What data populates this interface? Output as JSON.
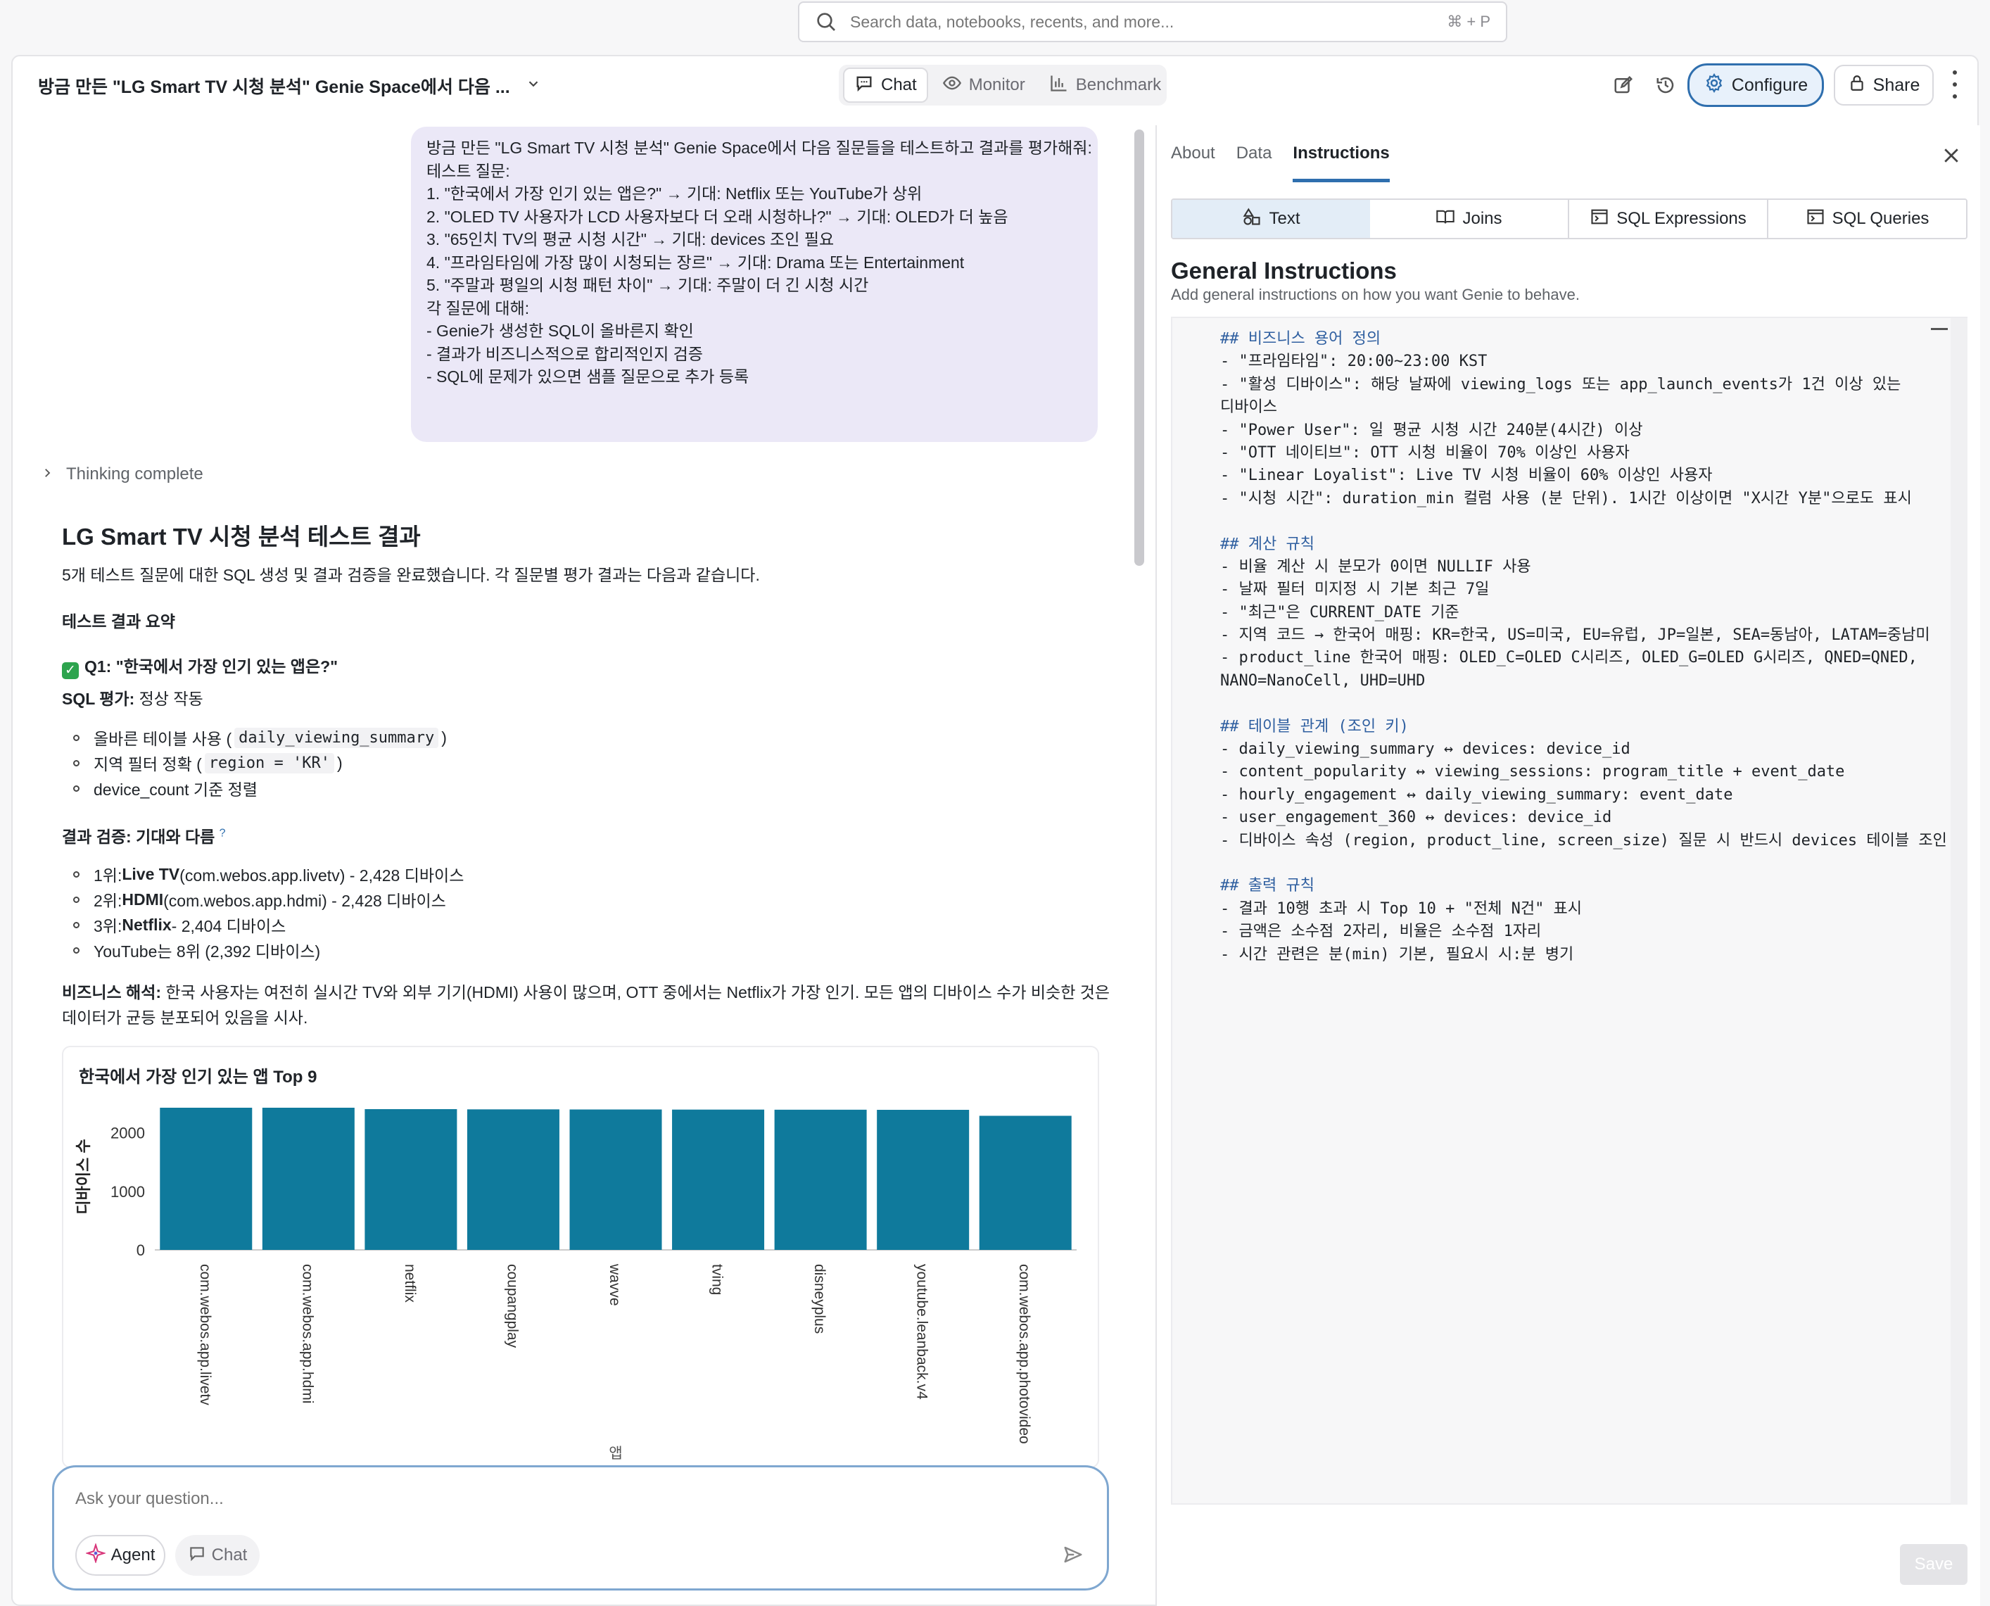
{
  "search": {
    "placeholder": "Search data, notebooks, recents, and more...",
    "shortcut": "⌘ + P"
  },
  "header": {
    "space_title": "방금 만든 \"LG Smart TV 시청 분석\" Genie Space에서 다음 ...",
    "tabs": [
      {
        "label": "Chat",
        "icon": "chat-bubble-icon"
      },
      {
        "label": "Monitor",
        "icon": "eye-icon"
      },
      {
        "label": "Benchmark",
        "icon": "bar-chart-icon"
      }
    ],
    "configure_label": "Configure",
    "share_label": "Share"
  },
  "user_message": [
    "방금 만든 \"LG Smart TV 시청 분석\" Genie Space에서 다음 질문들을 테스트하고 결과를 평가해줘:",
    "",
    "테스트 질문:",
    "1. \"한국에서 가장 인기 있는 앱은?\" → 기대: Netflix 또는 YouTube가 상위",
    "2. \"OLED TV 사용자가 LCD 사용자보다 더 오래 시청하나?\" → 기대: OLED가 더 높음",
    "3. \"65인치 TV의 평균 시청 시간\" → 기대: devices 조인 필요",
    "4. \"프라임타임에 가장 많이 시청되는 장르\" → 기대: Drama 또는 Entertainment",
    "5. \"주말과 평일의 시청 패턴 차이\" → 기대: 주말이 더 긴 시청 시간",
    "",
    "각 질문에 대해:",
    "- Genie가 생성한 SQL이 올바른지 확인",
    "- 결과가 비즈니스적으로 합리적인지 검증",
    "- SQL에 문제가 있으면 샘플 질문으로 추가 등록"
  ],
  "thinking_label": "Thinking complete",
  "response": {
    "title": "LG Smart TV 시청 분석 테스트 결과",
    "intro": "5개 테스트 질문에 대한 SQL 생성 및 결과 검증을 완료했습니다. 각 질문별 평가 결과는 다음과 같습니다.",
    "summary_heading": "테스트 결과 요약",
    "q1_heading": "Q1: \"한국에서 가장 인기 있는 앱은?\"",
    "sql_eval_label": "SQL 평가:",
    "sql_eval_value": " 정상 작동",
    "sql_bullets": [
      {
        "prefix": "올바른 테이블 사용 (",
        "code": "daily_viewing_summary",
        "suffix": ")"
      },
      {
        "prefix": "지역 필터 정확 (",
        "code": "region = 'KR'",
        "suffix": ")"
      },
      {
        "prefix": "device_count 기준 정렬",
        "code": "",
        "suffix": ""
      }
    ],
    "result_label": "결과 검증: 기대와 다름",
    "result_mark": "?",
    "result_bullets": [
      {
        "rank": "1위: ",
        "name": "Live TV",
        "rest": " (com.webos.app.livetv) - 2,428 디바이스"
      },
      {
        "rank": "2위: ",
        "name": "HDMI",
        "rest": " (com.webos.app.hdmi) - 2,428 디바이스"
      },
      {
        "rank": "3위: ",
        "name": "Netflix",
        "rest": " - 2,404 디바이스"
      },
      {
        "rank": "",
        "name": "",
        "rest": "YouTube는 8위 (2,392 디바이스)"
      }
    ],
    "biz_label": "비즈니스 해석:",
    "biz_line1": " 한국 사용자는 여전히 실시간 TV와 외부 기기(HDMI) 사용이 많으며, OTT 중에서는 Netflix가 가장 인기. 모든 앱의 디바이스 수가 비슷한 것은",
    "biz_line2": "데이터가 균등 분포되어 있음을 시사."
  },
  "chart_data": {
    "type": "bar",
    "title": "한국에서 가장 인기 있는 앱 Top 9",
    "categories": [
      "com.webos.app.livetv",
      "com.webos.app.hdmi",
      "netflix",
      "coupangplay",
      "wavve",
      "tving",
      "disneyplus",
      "youtube.leanback.v4",
      "com.webos.app.photovideo"
    ],
    "values": [
      2428,
      2428,
      2404,
      2400,
      2398,
      2396,
      2394,
      2392,
      2290
    ],
    "xlabel": "앱",
    "ylabel": "디바이스 수",
    "yticks": [
      "0",
      "1000",
      "2000"
    ],
    "ylim": [
      0,
      2500
    ],
    "color": "#0f7a9c"
  },
  "ask": {
    "placeholder": "Ask your question...",
    "agent_label": "Agent",
    "chat_label": "Chat"
  },
  "right_panel": {
    "tabs": [
      "About",
      "Data",
      "Instructions"
    ],
    "subtabs": [
      {
        "label": "Text",
        "icon": "shapes-icon"
      },
      {
        "label": "Joins",
        "icon": "book-icon"
      },
      {
        "label": "SQL Expressions",
        "icon": "terminal-icon"
      },
      {
        "label": "SQL Queries",
        "icon": "terminal-icon"
      }
    ],
    "heading": "General Instructions",
    "subheading": "Add general instructions on how you want Genie to behave.",
    "instructions": [
      "## 비즈니스 용어 정의",
      "- \"프라임타임\": 20:00~23:00 KST",
      "- \"활성 디바이스\": 해당 날짜에 viewing_logs 또는 app_launch_events가 1건 이상 있는",
      "디바이스",
      "- \"Power User\": 일 평균 시청 시간 240분(4시간) 이상",
      "- \"OTT 네이티브\": OTT 시청 비율이 70% 이상인 사용자",
      "- \"Linear Loyalist\": Live TV 시청 비율이 60% 이상인 사용자",
      "- \"시청 시간\": duration_min 컬럼 사용 (분 단위). 1시간 이상이면 \"X시간 Y분\"으로도 표시",
      "",
      "## 계산 규칙",
      "- 비율 계산 시 분모가 0이면 NULLIF 사용",
      "- 날짜 필터 미지정 시 기본 최근 7일",
      "- \"최근\"은 CURRENT_DATE 기준",
      "- 지역 코드 → 한국어 매핑: KR=한국, US=미국, EU=유럽, JP=일본, SEA=동남아, LATAM=중남미",
      "- product_line 한국어 매핑: OLED_C=OLED C시리즈, OLED_G=OLED G시리즈, QNED=QNED,",
      "NANO=NanoCell, UHD=UHD",
      "",
      "## 테이블 관계 (조인 키)",
      "- daily_viewing_summary ↔ devices: device_id",
      "- content_popularity ↔ viewing_sessions: program_title + event_date",
      "- hourly_engagement ↔ daily_viewing_summary: event_date",
      "- user_engagement_360 ↔ devices: device_id",
      "- 디바이스 속성 (region, product_line, screen_size) 질문 시 반드시 devices 테이블 조인",
      "",
      "## 출력 규칙",
      "- 결과 10행 초과 시 Top 10 + \"전체 N건\" 표시",
      "- 금액은 소수점 2자리, 비율은 소수점 1자리",
      "- 시간 관련은 분(min) 기본, 필요시 시:분 병기"
    ],
    "save_label": "Save"
  },
  "colors": {
    "accent": "#2f6fae",
    "bar": "#0f7a9c",
    "bubble": "#ebe8f7",
    "heading_md": "#2f5fa0"
  }
}
